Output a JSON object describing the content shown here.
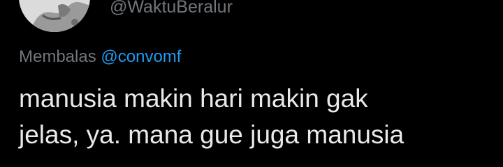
{
  "author": {
    "handle": "@WaktuBeralur",
    "avatar_icon": "profile-photo"
  },
  "reply": {
    "prefix": "Membalas",
    "mention": "@convomf"
  },
  "tweet": {
    "lines": [
      "manusia makin hari makin gak",
      "jelas, ya. mana gue juga manusia"
    ]
  },
  "colors": {
    "background": "#000000",
    "text_primary": "#e7e9ea",
    "text_secondary": "#71767b",
    "accent": "#1d9bf0"
  }
}
